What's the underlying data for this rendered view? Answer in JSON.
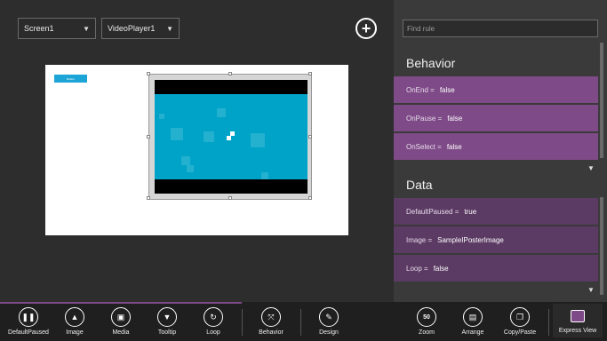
{
  "toolbar": {
    "screen_select": "Screen1",
    "control_select": "VideoPlayer1",
    "add_symbol": "+"
  },
  "canvas": {
    "button_label": "Button"
  },
  "panel": {
    "search_placeholder": "Find rule",
    "behavior_title": "Behavior",
    "behavior_rules": [
      {
        "name": "OnEnd",
        "value": "false"
      },
      {
        "name": "OnPause",
        "value": "false"
      },
      {
        "name": "OnSelect",
        "value": "false"
      }
    ],
    "data_title": "Data",
    "data_rules": [
      {
        "name": "DefaultPaused",
        "value": "true"
      },
      {
        "name": "Image",
        "value": "SampleIPosterImage"
      },
      {
        "name": "Loop",
        "value": "false"
      }
    ],
    "equals": "="
  },
  "bottombar": {
    "tools": [
      {
        "label": "DefaultPaused",
        "icon": "pause-icon",
        "glyph": "❚❚"
      },
      {
        "label": "Image",
        "icon": "image-icon",
        "glyph": "▲"
      },
      {
        "label": "Media",
        "icon": "media-icon",
        "glyph": "▣"
      },
      {
        "label": "Tooltip",
        "icon": "tooltip-icon",
        "glyph": "▼"
      },
      {
        "label": "Loop",
        "icon": "loop-icon",
        "glyph": "↻"
      },
      {
        "label": "Behavior",
        "icon": "behavior-icon",
        "glyph": "⤧"
      },
      {
        "label": "Design",
        "icon": "design-icon",
        "glyph": "✎"
      },
      {
        "label": "Zoom",
        "icon": "zoom-icon",
        "glyph": "50"
      },
      {
        "label": "Arrange",
        "icon": "arrange-icon",
        "glyph": "▤"
      },
      {
        "label": "Copy/Paste",
        "icon": "copy-paste-icon",
        "glyph": "❐"
      },
      {
        "label": "Express View",
        "icon": "express-view-icon",
        "glyph": ""
      }
    ]
  },
  "colors": {
    "behavior_row": "#7e4a87",
    "data_row": "#5b3a63",
    "video_screen": "#00a3c8",
    "canvas_button": "#1ea5d8"
  }
}
